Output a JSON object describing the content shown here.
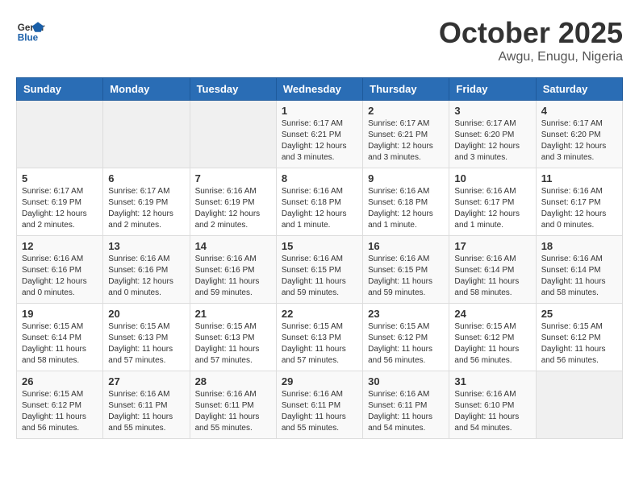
{
  "header": {
    "logo_general": "General",
    "logo_blue": "Blue",
    "month_title": "October 2025",
    "location": "Awgu, Enugu, Nigeria"
  },
  "days_of_week": [
    "Sunday",
    "Monday",
    "Tuesday",
    "Wednesday",
    "Thursday",
    "Friday",
    "Saturday"
  ],
  "weeks": [
    {
      "days": [
        {
          "num": "",
          "info": ""
        },
        {
          "num": "",
          "info": ""
        },
        {
          "num": "",
          "info": ""
        },
        {
          "num": "1",
          "info": "Sunrise: 6:17 AM\nSunset: 6:21 PM\nDaylight: 12 hours\nand 3 minutes."
        },
        {
          "num": "2",
          "info": "Sunrise: 6:17 AM\nSunset: 6:21 PM\nDaylight: 12 hours\nand 3 minutes."
        },
        {
          "num": "3",
          "info": "Sunrise: 6:17 AM\nSunset: 6:20 PM\nDaylight: 12 hours\nand 3 minutes."
        },
        {
          "num": "4",
          "info": "Sunrise: 6:17 AM\nSunset: 6:20 PM\nDaylight: 12 hours\nand 3 minutes."
        }
      ]
    },
    {
      "days": [
        {
          "num": "5",
          "info": "Sunrise: 6:17 AM\nSunset: 6:19 PM\nDaylight: 12 hours\nand 2 minutes."
        },
        {
          "num": "6",
          "info": "Sunrise: 6:17 AM\nSunset: 6:19 PM\nDaylight: 12 hours\nand 2 minutes."
        },
        {
          "num": "7",
          "info": "Sunrise: 6:16 AM\nSunset: 6:19 PM\nDaylight: 12 hours\nand 2 minutes."
        },
        {
          "num": "8",
          "info": "Sunrise: 6:16 AM\nSunset: 6:18 PM\nDaylight: 12 hours\nand 1 minute."
        },
        {
          "num": "9",
          "info": "Sunrise: 6:16 AM\nSunset: 6:18 PM\nDaylight: 12 hours\nand 1 minute."
        },
        {
          "num": "10",
          "info": "Sunrise: 6:16 AM\nSunset: 6:17 PM\nDaylight: 12 hours\nand 1 minute."
        },
        {
          "num": "11",
          "info": "Sunrise: 6:16 AM\nSunset: 6:17 PM\nDaylight: 12 hours\nand 0 minutes."
        }
      ]
    },
    {
      "days": [
        {
          "num": "12",
          "info": "Sunrise: 6:16 AM\nSunset: 6:16 PM\nDaylight: 12 hours\nand 0 minutes."
        },
        {
          "num": "13",
          "info": "Sunrise: 6:16 AM\nSunset: 6:16 PM\nDaylight: 12 hours\nand 0 minutes."
        },
        {
          "num": "14",
          "info": "Sunrise: 6:16 AM\nSunset: 6:16 PM\nDaylight: 11 hours\nand 59 minutes."
        },
        {
          "num": "15",
          "info": "Sunrise: 6:16 AM\nSunset: 6:15 PM\nDaylight: 11 hours\nand 59 minutes."
        },
        {
          "num": "16",
          "info": "Sunrise: 6:16 AM\nSunset: 6:15 PM\nDaylight: 11 hours\nand 59 minutes."
        },
        {
          "num": "17",
          "info": "Sunrise: 6:16 AM\nSunset: 6:14 PM\nDaylight: 11 hours\nand 58 minutes."
        },
        {
          "num": "18",
          "info": "Sunrise: 6:16 AM\nSunset: 6:14 PM\nDaylight: 11 hours\nand 58 minutes."
        }
      ]
    },
    {
      "days": [
        {
          "num": "19",
          "info": "Sunrise: 6:15 AM\nSunset: 6:14 PM\nDaylight: 11 hours\nand 58 minutes."
        },
        {
          "num": "20",
          "info": "Sunrise: 6:15 AM\nSunset: 6:13 PM\nDaylight: 11 hours\nand 57 minutes."
        },
        {
          "num": "21",
          "info": "Sunrise: 6:15 AM\nSunset: 6:13 PM\nDaylight: 11 hours\nand 57 minutes."
        },
        {
          "num": "22",
          "info": "Sunrise: 6:15 AM\nSunset: 6:13 PM\nDaylight: 11 hours\nand 57 minutes."
        },
        {
          "num": "23",
          "info": "Sunrise: 6:15 AM\nSunset: 6:12 PM\nDaylight: 11 hours\nand 56 minutes."
        },
        {
          "num": "24",
          "info": "Sunrise: 6:15 AM\nSunset: 6:12 PM\nDaylight: 11 hours\nand 56 minutes."
        },
        {
          "num": "25",
          "info": "Sunrise: 6:15 AM\nSunset: 6:12 PM\nDaylight: 11 hours\nand 56 minutes."
        }
      ]
    },
    {
      "days": [
        {
          "num": "26",
          "info": "Sunrise: 6:15 AM\nSunset: 6:12 PM\nDaylight: 11 hours\nand 56 minutes."
        },
        {
          "num": "27",
          "info": "Sunrise: 6:16 AM\nSunset: 6:11 PM\nDaylight: 11 hours\nand 55 minutes."
        },
        {
          "num": "28",
          "info": "Sunrise: 6:16 AM\nSunset: 6:11 PM\nDaylight: 11 hours\nand 55 minutes."
        },
        {
          "num": "29",
          "info": "Sunrise: 6:16 AM\nSunset: 6:11 PM\nDaylight: 11 hours\nand 55 minutes."
        },
        {
          "num": "30",
          "info": "Sunrise: 6:16 AM\nSunset: 6:11 PM\nDaylight: 11 hours\nand 54 minutes."
        },
        {
          "num": "31",
          "info": "Sunrise: 6:16 AM\nSunset: 6:10 PM\nDaylight: 11 hours\nand 54 minutes."
        },
        {
          "num": "",
          "info": ""
        }
      ]
    }
  ]
}
